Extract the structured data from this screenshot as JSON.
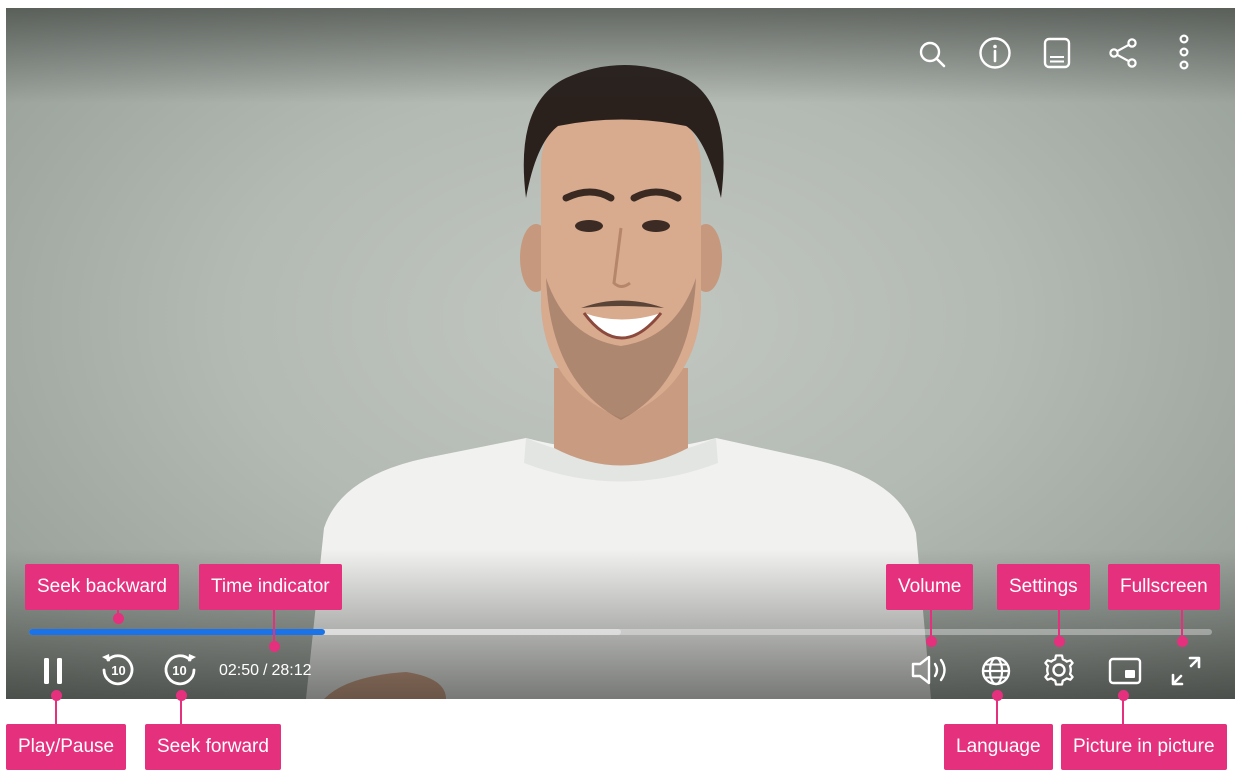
{
  "player": {
    "current_time": "02:50",
    "separator": "/",
    "duration": "28:12",
    "progress_played_fraction": 0.25,
    "progress_buffered_fraction": 0.5,
    "accent_color": "#1a73e8",
    "top_icons": [
      "search-icon",
      "info-icon",
      "subtitles-icon",
      "share-icon",
      "more-vertical-icon"
    ],
    "bottom_left_icons": [
      "pause-icon",
      "replay-10-icon",
      "forward-10-icon"
    ],
    "bottom_right_icons": [
      "volume-icon",
      "globe-icon",
      "gear-icon",
      "picture-in-picture-icon",
      "expand-icon"
    ],
    "seek_step": "10"
  },
  "annotations": {
    "color": "#e5307d",
    "seek_backward": "Seek backward",
    "time_indicator": "Time indicator",
    "volume": "Volume",
    "settings": "Settings",
    "fullscreen": "Fullscreen",
    "play_pause": "Play/Pause",
    "seek_forward": "Seek forward",
    "language": "Language",
    "picture_in_picture": "Picture in picture"
  }
}
